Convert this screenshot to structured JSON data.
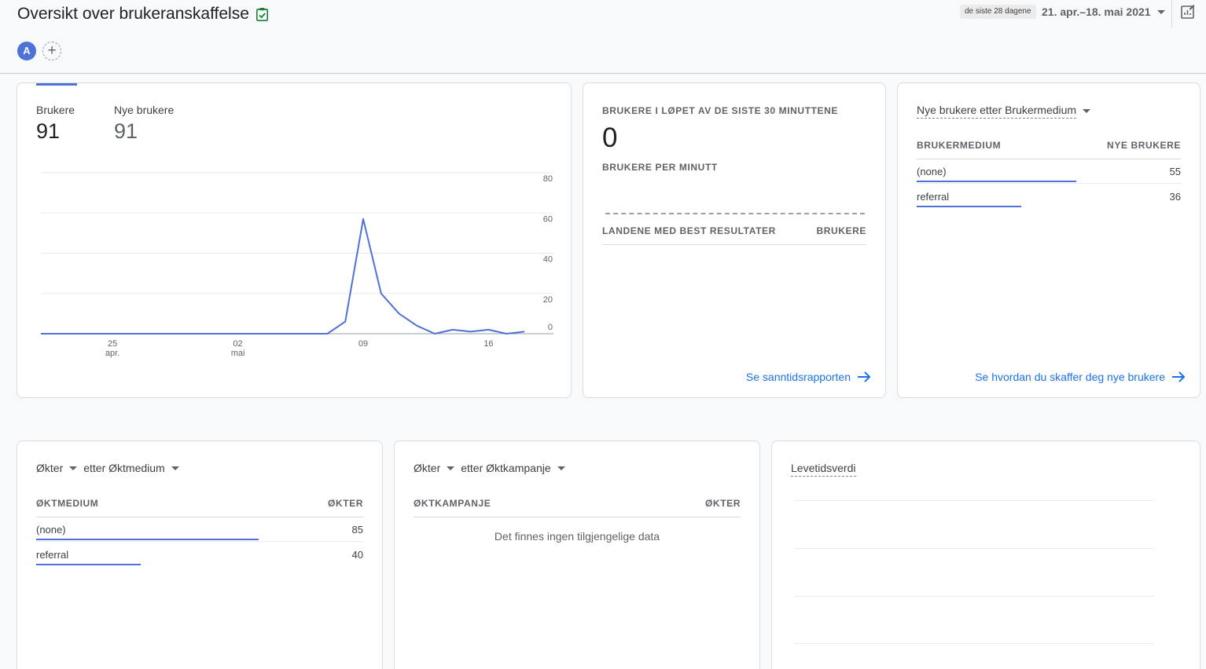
{
  "header": {
    "title": "Oversikt over brukeranskaffelse",
    "date_chip": "de siste 28 dagene",
    "date_range": "21. apr.–18. mai 2021",
    "avatar_letter": "A",
    "add_label": "+"
  },
  "users_card": {
    "metric1_label": "Brukere",
    "metric1_value": "91",
    "metric2_label": "Nye brukere",
    "metric2_value": "91",
    "accent_color": "#4e72d6"
  },
  "chart_data": {
    "type": "line",
    "title": "",
    "xlabel": "",
    "ylabel": "",
    "ylim": [
      0,
      80
    ],
    "yticks": [
      "80",
      "60",
      "40",
      "20",
      "0"
    ],
    "xticks": [
      {
        "day": "25",
        "month": "apr."
      },
      {
        "day": "02",
        "month": "mai"
      },
      {
        "day": "09",
        "month": ""
      },
      {
        "day": "16",
        "month": ""
      }
    ],
    "xtick_index": [
      4,
      11,
      18,
      25
    ],
    "series": [
      {
        "values": [
          0,
          0,
          0,
          0,
          0,
          0,
          0,
          0,
          0,
          0,
          0,
          0,
          0,
          0,
          0,
          0,
          0,
          6,
          57,
          20,
          10,
          4,
          0,
          2,
          1,
          2,
          0,
          1
        ]
      }
    ],
    "grid": true
  },
  "realtime_card": {
    "heading": "BRUKERE I LØPET AV DE SISTE 30 MINUTTENE",
    "value": "0",
    "per_minute": "BRUKERE PER MINUTT",
    "col1": "LANDENE MED BEST RESULTATER",
    "col2": "BRUKERE",
    "link": "Se sanntidsrapporten"
  },
  "newusers_card": {
    "title_prefix": "Nye brukere etter ",
    "title_dim": "Brukermedium",
    "col1": "BRUKERMEDIUM",
    "col2": "NYE BRUKERE",
    "rows": [
      {
        "label": "(none)",
        "value": "55",
        "share": 0.604
      },
      {
        "label": "referral",
        "value": "36",
        "share": 0.396
      }
    ],
    "link": "Se hvordan du skaffer deg nye brukere"
  },
  "sessions_medium_card": {
    "metric": "Økter",
    "dim": "etter Øktmedium",
    "col1": "ØKTMEDIUM",
    "col2": "ØKTER",
    "rows": [
      {
        "label": "(none)",
        "value": "85",
        "share": 0.68
      },
      {
        "label": "referral",
        "value": "40",
        "share": 0.32
      }
    ]
  },
  "sessions_campaign_card": {
    "metric": "Økter",
    "dim": "etter Øktkampanje",
    "col1": "ØKTKAMPANJE",
    "col2": "ØKTER",
    "empty": "Det finnes ingen tilgjengelige data"
  },
  "ltv_card": {
    "title": "Levetidsverdi"
  }
}
